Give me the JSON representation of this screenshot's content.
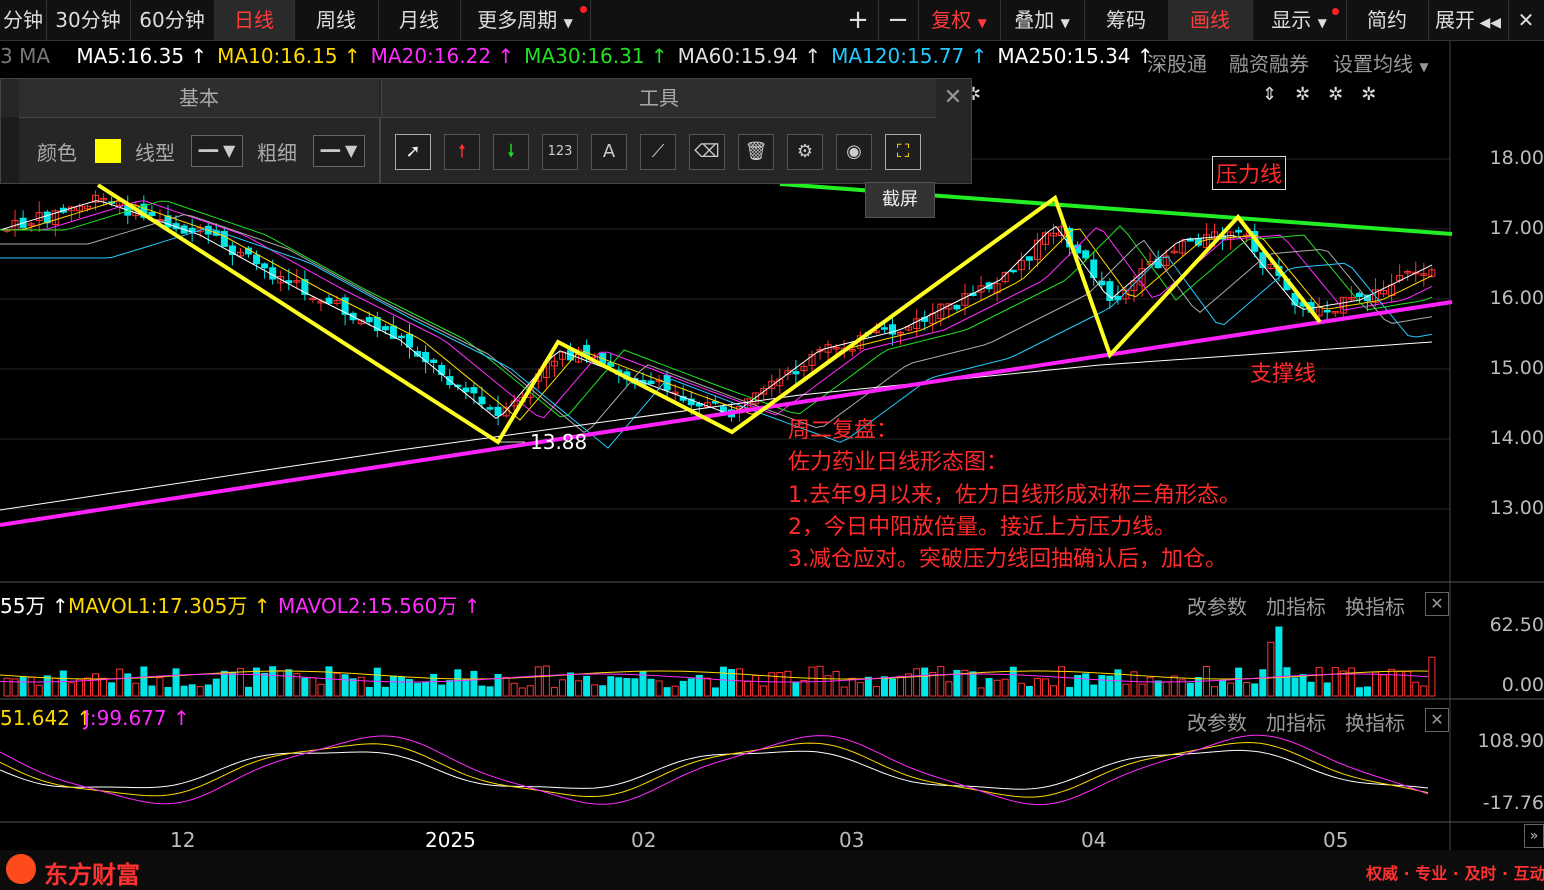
{
  "topbar": {
    "periods": [
      "分钟",
      "30分钟",
      "60分钟",
      "日线",
      "周线",
      "月线",
      "更多周期"
    ],
    "right": [
      "复权",
      "叠加",
      "筹码",
      "画线",
      "显示",
      "简约",
      "展开"
    ]
  },
  "ma": {
    "prefix": "MA",
    "items": [
      {
        "label": "MA5:16.35",
        "color": "#ffffff"
      },
      {
        "label": "MA10:16.15",
        "color": "#ffd800"
      },
      {
        "label": "MA20:16.22",
        "color": "#ff2cff"
      },
      {
        "label": "MA30:16.31",
        "color": "#22e022"
      },
      {
        "label": "MA60:15.94",
        "color": "#dddddd"
      },
      {
        "label": "MA120:15.77",
        "color": "#26c9ff"
      },
      {
        "label": "MA250:15.34",
        "color": "#ffffff"
      }
    ],
    "right_links": [
      "深股通",
      "融资融券",
      "设置均线"
    ]
  },
  "panel": {
    "tab_basic": "基本",
    "tab_tools": "工具",
    "color_label": "颜色",
    "linetype_label": "线型",
    "thickness_label": "粗细",
    "screenshot_tooltip": "截屏"
  },
  "price_axis": [
    "18.00",
    "17.00",
    "16.00",
    "15.00",
    "14.00",
    "13.00"
  ],
  "annotations": {
    "low_price": "13.88",
    "resistance": "压力线",
    "support": "支撑线",
    "lines": [
      "周二复盘：",
      "佐力药业日线形态图：",
      "1.去年9月以来，佐力日线形成对称三角形态。",
      "2，今日中阳放倍量。接近上方压力线。",
      "3.减仓应对。突破压力线回抽确认后，加仓。"
    ]
  },
  "volume": {
    "vol_label": "55万",
    "mavol1": "MAVOL1:17.305万",
    "mavol2": "MAVOL2:15.560万",
    "axis": [
      "62.50",
      "0.00"
    ]
  },
  "kdj": {
    "d_label": "51.642",
    "j_label": "J:99.677",
    "axis": [
      "108.90",
      "-17.76"
    ]
  },
  "indicator_buttons": [
    "改参数",
    "加指标",
    "换指标"
  ],
  "x_axis": [
    "12",
    "2025",
    "02",
    "03",
    "04",
    "05"
  ],
  "brand": "东方财富",
  "slogan": "权威 · 专业 · 及时 · 互动",
  "colors": {
    "up": "#ff3232",
    "down": "#00e5e5",
    "resistance": "#22ee22",
    "support": "#ff22ff",
    "pattern": "#ffff22"
  }
}
